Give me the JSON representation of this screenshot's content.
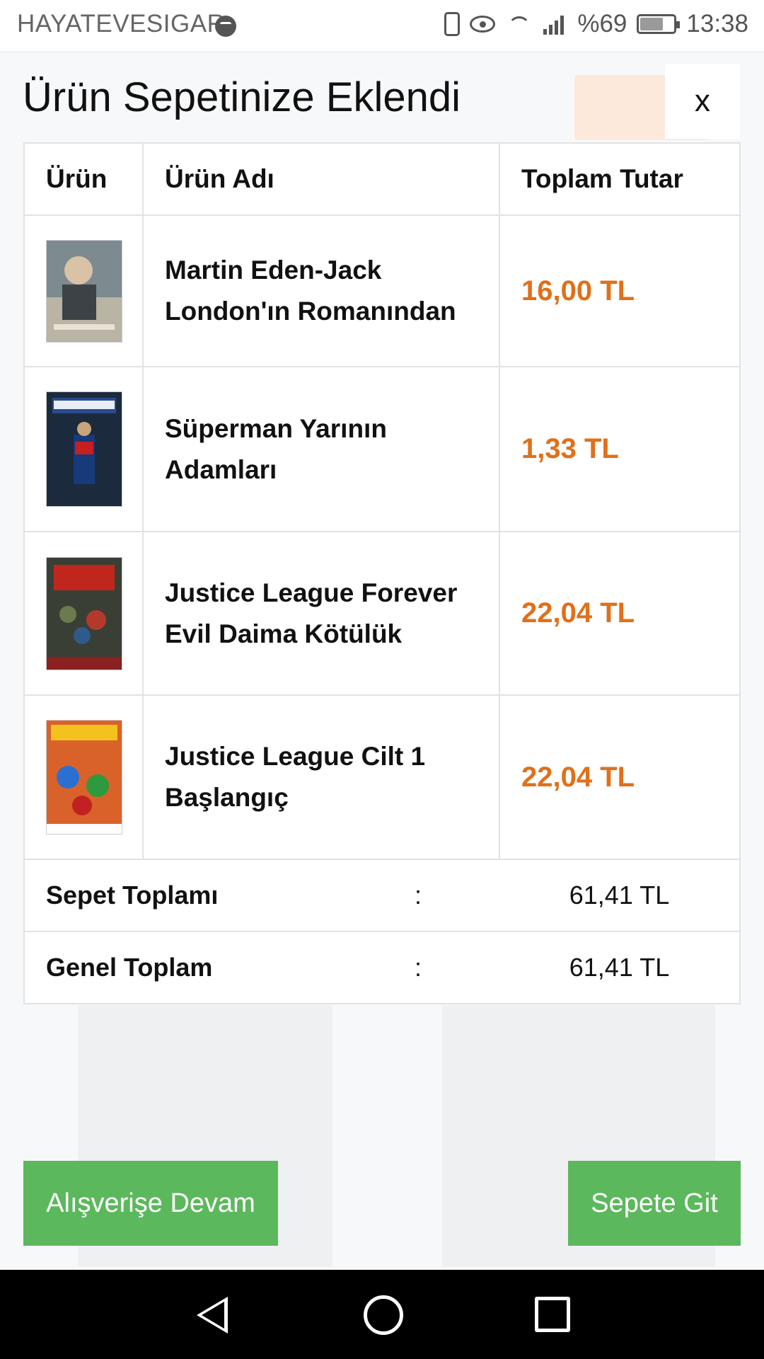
{
  "status_bar": {
    "carrier": "HAYATEVESIGAR",
    "battery": "%69",
    "time": "13:38"
  },
  "modal": {
    "title": "Ürün Sepetinize Eklendi",
    "close_label": "x"
  },
  "table": {
    "headers": [
      "Ürün",
      "Ürün Adı",
      "Toplam Tutar"
    ],
    "rows": [
      {
        "name": "Martin Eden-Jack London'ın Romanından",
        "price": "16,00 TL"
      },
      {
        "name": "Süperman Yarının Adamları",
        "price": "1,33 TL"
      },
      {
        "name": "Justice League Forever Evil Daima Kötülük",
        "price": "22,04 TL"
      },
      {
        "name": "Justice League Cilt 1 Başlangıç",
        "price": "22,04 TL"
      }
    ],
    "summary": [
      {
        "label": "Sepet Toplamı",
        "colon": ":",
        "value": "61,41 TL"
      },
      {
        "label": "Genel Toplam",
        "colon": ":",
        "value": "61,41 TL"
      }
    ]
  },
  "buttons": {
    "continue_label": "Alışverişe Devam",
    "go_to_cart_label": "Sepete Git"
  },
  "colors": {
    "price": "#e0701a",
    "button_green": "#5cb85c"
  }
}
